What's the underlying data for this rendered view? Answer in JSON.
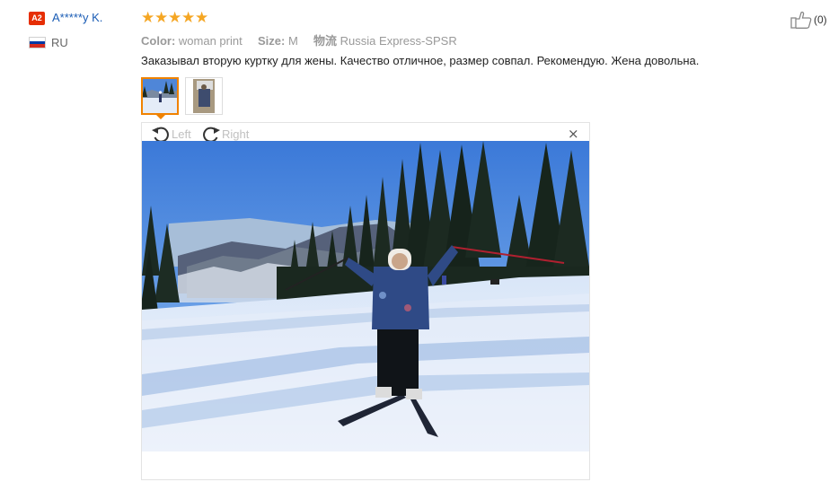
{
  "reviewer": {
    "level_badge": "A2",
    "name": "A*****y K.",
    "country": "RU",
    "flag_colors": [
      "#ffffff",
      "#0039a6",
      "#d52b1e"
    ]
  },
  "rating": {
    "stars": [
      "★",
      "★",
      "★",
      "★",
      "★"
    ],
    "value": 5,
    "star_color": "#f5a623"
  },
  "attributes": {
    "color_label": "Color:",
    "color_value": "woman print",
    "size_label": "Size:",
    "size_value": "M",
    "shipping_icon_text": "物流",
    "shipping_value": "Russia Express-SPSR"
  },
  "review_text": "Заказывал вторую куртку для жены. Качество отличное, размер совпал. Рекомендую. Жена довольна.",
  "photo_viewer": {
    "rotate_left_label": "Left",
    "rotate_right_label": "Right",
    "close_symbol": "×"
  },
  "helpful": {
    "count": "(0)"
  },
  "colors": {
    "accent": "#f08200",
    "link": "#1a5cb5",
    "badge": "#e62e04"
  }
}
